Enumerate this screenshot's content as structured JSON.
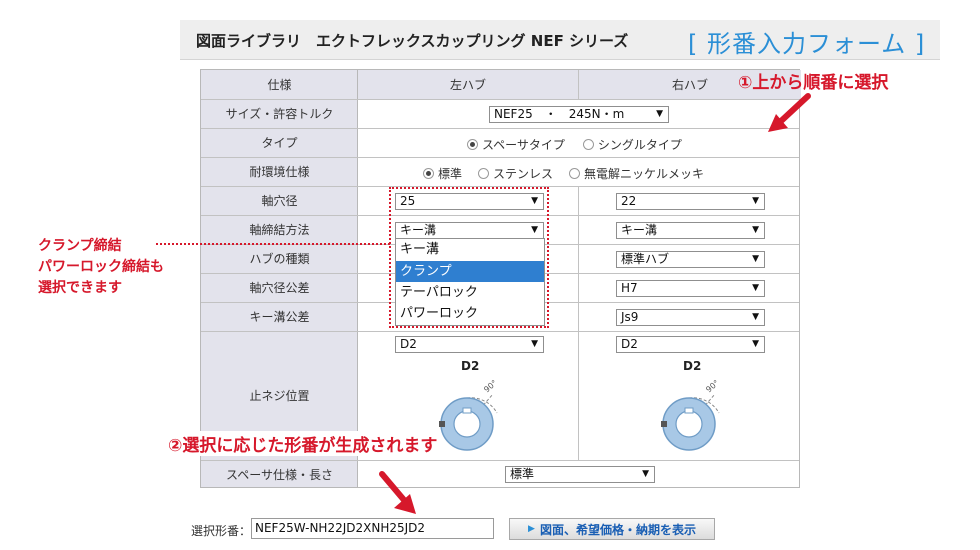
{
  "header": {
    "title": "図面ライブラリ　エクトフレックスカップリング NEF シリーズ",
    "form_label": "[ 形番入力フォーム ]"
  },
  "table": {
    "col_headers": [
      "仕様",
      "左ハブ",
      "右ハブ"
    ],
    "rows": {
      "size_label": "サイズ・許容トルク",
      "size_value": "NEF25　・　245N・m",
      "type_label": "タイプ",
      "type_options": [
        "スペーサタイプ",
        "シングルタイプ"
      ],
      "type_selected": "スペーサタイプ",
      "env_label": "耐環境仕様",
      "env_options": [
        "標準",
        "ステンレス",
        "無電解ニッケルメッキ"
      ],
      "env_selected": "標準",
      "bore_label": "軸穴径",
      "bore_left": "25",
      "bore_right": "22",
      "fasten_label": "軸締結方法",
      "fasten_left": "キー溝",
      "fasten_right": "キー溝",
      "hub_label": "ハブの種類",
      "hub_right": "標準ハブ",
      "tol_label": "軸穴径公差",
      "tol_right": "H7",
      "keytol_label": "キー溝公差",
      "keytol_right": "Js9",
      "setscrew_label": "止ネジ位置",
      "setscrew_left": "D2",
      "setscrew_right": "D2",
      "diagram_label_left": "D2",
      "diagram_label_right": "D2",
      "diagram_angle": "90°",
      "spacer_label": "スペーサ仕様・長さ",
      "spacer_value": "標準"
    },
    "dropdown_options": [
      "キー溝",
      "クランプ",
      "テーパロック",
      "パワーロック"
    ],
    "dropdown_highlight": "クランプ"
  },
  "annotations": {
    "step1": "①上から順番に選択",
    "clamp_note": [
      "クランプ締結",
      "パワーロック締結も",
      "選択できます"
    ],
    "step2": "②選択に応じた形番が生成されます"
  },
  "result": {
    "label": "選択形番：",
    "value": "NEF25W-NH22JD2XNH25JD2",
    "button_label": "図面、希望価格・納期を表示"
  },
  "colors": {
    "accent_blue": "#2b8fd6",
    "annotation_red": "#d6182b",
    "header_bg": "#eeeeee",
    "label_bg": "#e3e3ec",
    "highlight_blue": "#2f7fd0"
  },
  "icons": {
    "dropdown": "chevron-down-icon",
    "radio": "radio-icon",
    "arrow": "red-arrow-icon",
    "button": "triangle-right-icon"
  }
}
